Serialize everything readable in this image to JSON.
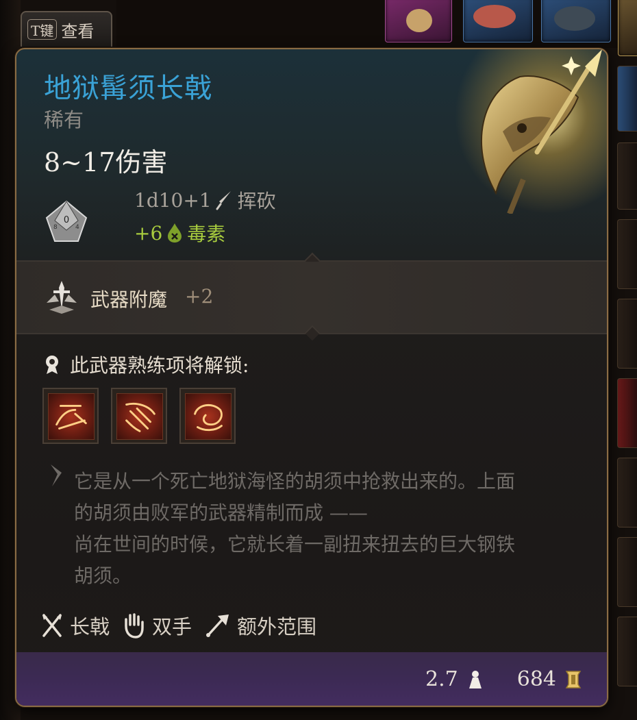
{
  "key_hint": {
    "key": "T键",
    "label": "查看"
  },
  "item": {
    "name": "地狱髯须长戟",
    "rarity": "稀有",
    "damage_summary": "8~17伤害",
    "damage_lines": [
      {
        "value": "1d10+1",
        "type": "挥砍",
        "icon": "slashing-icon"
      },
      {
        "value": "+6",
        "type": "毒素",
        "icon": "poison-icon"
      }
    ],
    "enchantment": {
      "label": "武器附魔",
      "bonus": "+2"
    },
    "proficiency": {
      "text": "此武器熟练项将解锁:",
      "actions": [
        "action-icon-1",
        "action-icon-2",
        "action-icon-3"
      ]
    },
    "description_lines": [
      "它是从一个死亡地狱海怪的胡须中抢救出来的。上面",
      "的胡须由败军的武器精制而成 ——",
      "尚在世间的时候，它就长着一副扭来扭去的巨大钢铁",
      "胡须。"
    ],
    "tags": [
      {
        "label": "长戟",
        "icon": "crossed-weapons-icon"
      },
      {
        "label": "双手",
        "icon": "hand-icon"
      },
      {
        "label": "额外范围",
        "icon": "reach-icon"
      }
    ],
    "weight": "2.7",
    "value": "684"
  },
  "colors": {
    "title": "#3aa2d6",
    "poison": "#a8cc3e",
    "panel_border": "#8a6c45",
    "footer": "#432c5f"
  }
}
